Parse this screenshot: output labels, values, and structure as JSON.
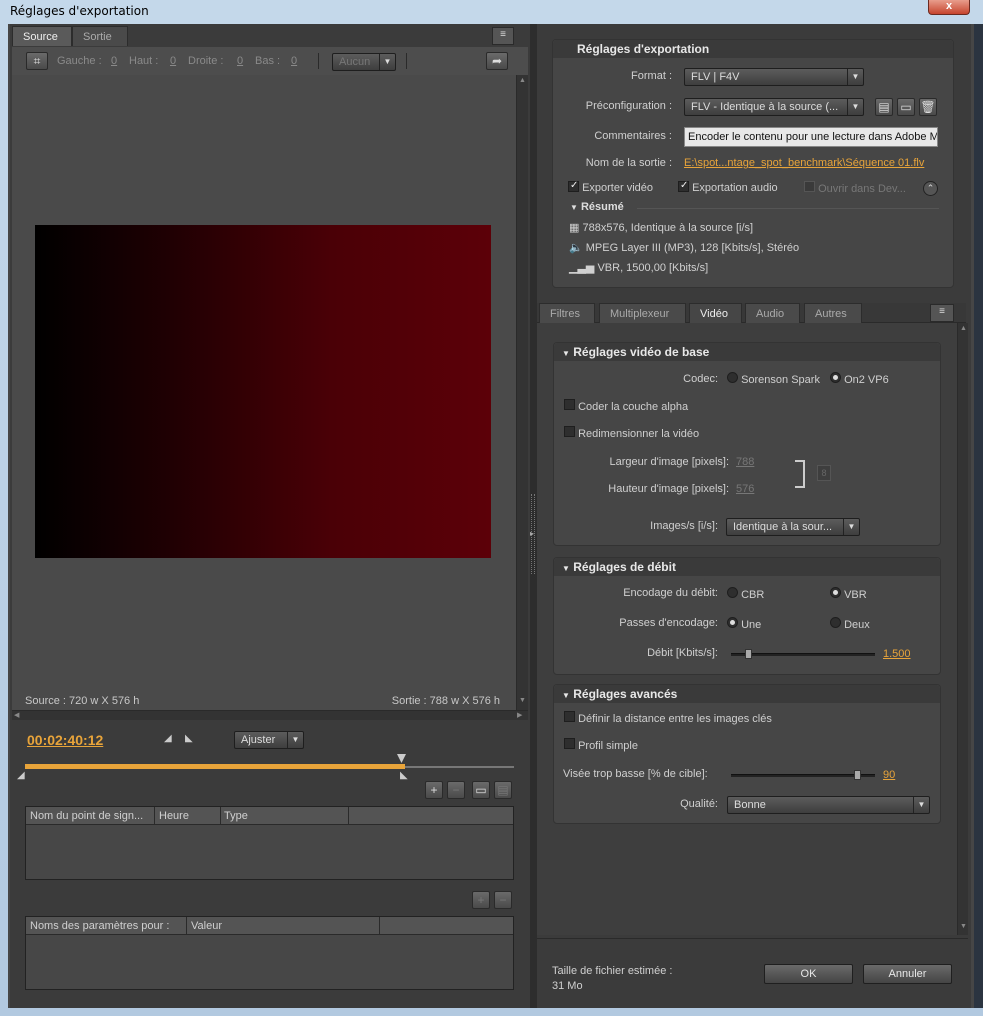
{
  "window": {
    "title": "Réglages d'exportation",
    "close_label": "x"
  },
  "left": {
    "tabs": [
      {
        "label": "Source"
      },
      {
        "label": "Sortie"
      }
    ],
    "crop": {
      "gauche_label": "Gauche :",
      "gauche_val": "0",
      "haut_label": "Haut :",
      "haut_val": "0",
      "droite_label": "Droite :",
      "droite_val": "0",
      "bas_label": "Bas :",
      "bas_val": "0",
      "ratio": "Aucun"
    },
    "source_info": "Source : 720 w X 576 h",
    "output_info": "Sortie : 788 w X 576 h",
    "timecode": "00:02:40:12",
    "fit": "Ajuster",
    "cue_table": {
      "col1": "Nom du point de sign...",
      "col2": "Heure",
      "col3": "Type"
    },
    "param_table": {
      "col1": "Noms des paramètres pour :",
      "col2": "Valeur"
    }
  },
  "export": {
    "header": "Réglages d'exportation",
    "format_label": "Format :",
    "format_value": "FLV | F4V",
    "preset_label": "Préconfiguration :",
    "preset_value": "FLV - Identique à la source (...",
    "comments_label": "Commentaires :",
    "comments_value": "Encoder le contenu pour une lecture dans Adobe Me",
    "output_label": "Nom de la sortie :",
    "output_value": "E:\\spot...ntage_spot_benchmark\\Séquence 01.flv",
    "export_video": "Exporter vidéo",
    "export_audio": "Exportation audio",
    "open_in": "Ouvrir dans Dev...",
    "summary_label": "Résumé",
    "summary_1": "788x576, Identique à la source [i/s]",
    "summary_2": "MPEG Layer III (MP3), 128 [Kbits/s], Stéréo",
    "summary_3": "VBR, 1500,00 [Kbits/s]"
  },
  "tabs2": [
    {
      "label": "Filtres"
    },
    {
      "label": "Multiplexeur"
    },
    {
      "label": "Vidéo"
    },
    {
      "label": "Audio"
    },
    {
      "label": "Autres"
    }
  ],
  "video_basic": {
    "header": "Réglages vidéo de base",
    "codec_label": "Codec:",
    "codec_opt1": "Sorenson Spark",
    "codec_opt2": "On2 VP6",
    "alpha": "Coder la couche alpha",
    "resize": "Redimensionner la vidéo",
    "width_label": "Largeur d'image [pixels]:",
    "width_value": "788",
    "height_label": "Hauteur d'image [pixels]:",
    "height_value": "576",
    "fps_label": "Images/s [i/s]:",
    "fps_value": "Identique à la sour..."
  },
  "bitrate": {
    "header": "Réglages de débit",
    "enc_label": "Encodage du débit:",
    "enc_opt1": "CBR",
    "enc_opt2": "VBR",
    "pass_label": "Passes d'encodage:",
    "pass_opt1": "Une",
    "pass_opt2": "Deux",
    "rate_label": "Débit [Kbits/s]:",
    "rate_value": "1.500",
    "rate_level": 0.1
  },
  "advanced": {
    "header": "Réglages avancés",
    "keyframe": "Définir la distance entre les images clés",
    "simple_profile": "Profil simple",
    "undershoot_label": "Visée trop basse [% de cible]:",
    "undershoot_value": "90",
    "undershoot_level": 0.9,
    "quality_label": "Qualité:",
    "quality_value": "Bonne"
  },
  "footer": {
    "size_label": "Taille de fichier estimée :",
    "size_value": "31 Mo",
    "ok": "OK",
    "cancel": "Annuler"
  }
}
